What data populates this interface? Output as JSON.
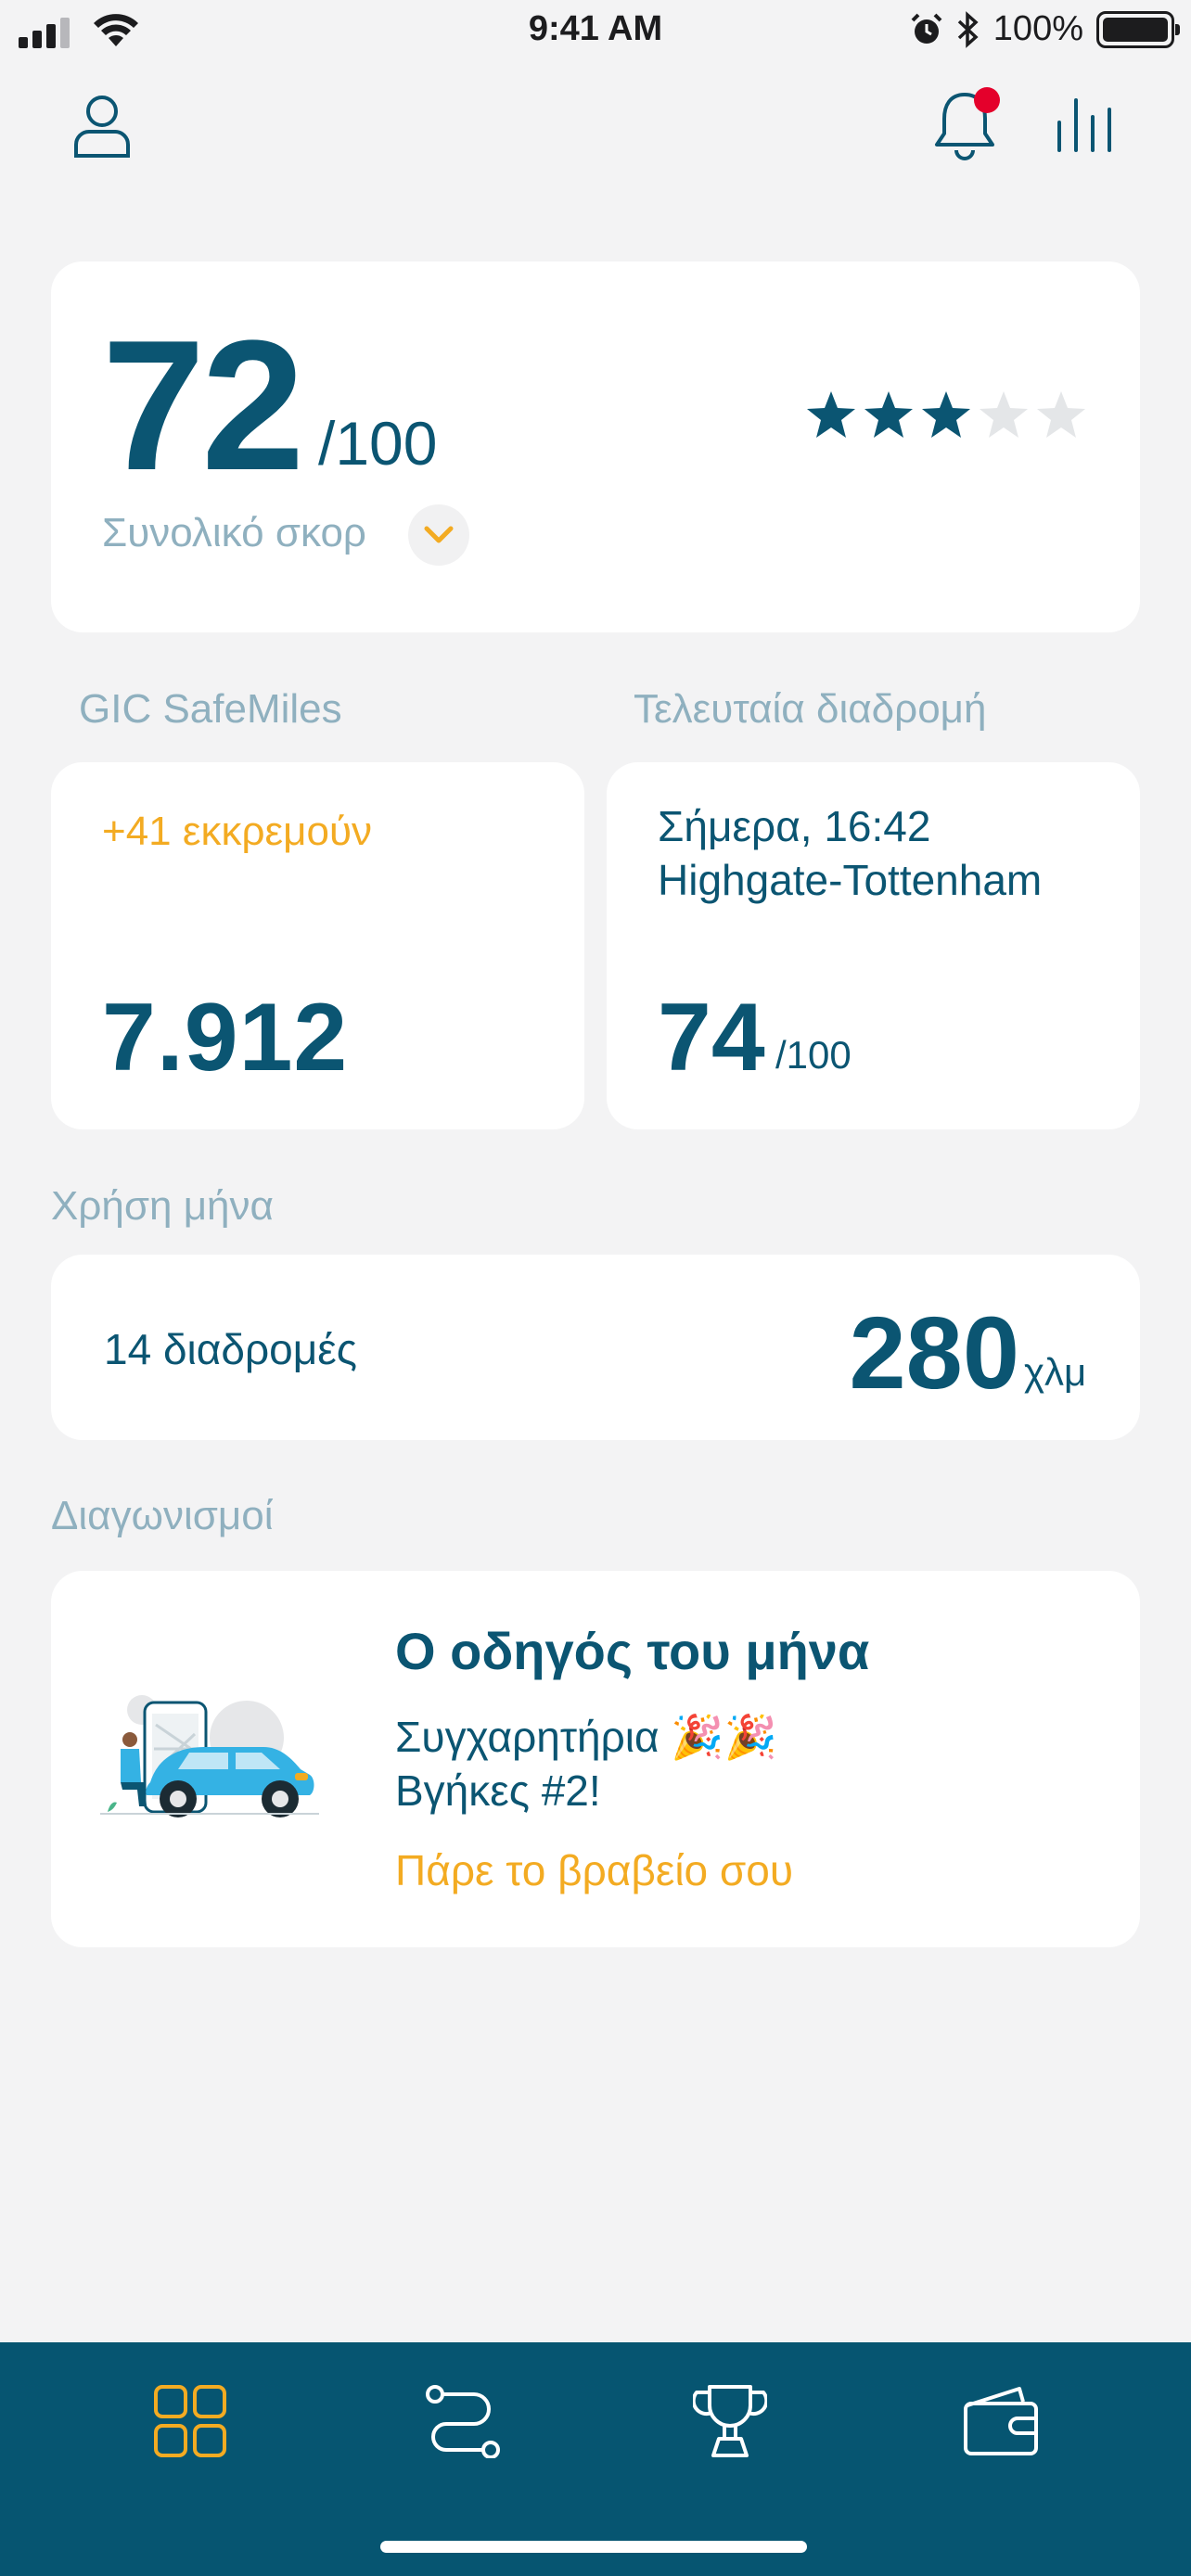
{
  "status_bar": {
    "time": "9:41 AM",
    "battery": "100%",
    "icons": [
      "signal-icon",
      "wifi-icon",
      "alarm-icon",
      "bluetooth-icon",
      "battery-icon"
    ]
  },
  "header": {
    "icons": [
      "profile-icon",
      "notification-bell-icon",
      "stats-icon"
    ],
    "has_notification": true
  },
  "score_card": {
    "score": "72",
    "out_of": "/100",
    "label": "Συνολικό σκορ",
    "stars_filled": 3,
    "stars_total": 5
  },
  "safemiles": {
    "section_title": "GIC SafeMiles",
    "pending": "+41 εκκρεμούν",
    "value": "7.912"
  },
  "last_trip": {
    "section_title": "Τελευταία διαδρομή",
    "when": "Σήμερα, 16:42",
    "route": "Highgate-Tottenham",
    "score": "74",
    "out_of": "/100"
  },
  "monthly_usage": {
    "section_title": "Χρήση μήνα",
    "trips": "14 διαδρομές",
    "distance": "280",
    "unit": "χλμ"
  },
  "competitions": {
    "section_title": "Διαγωνισμοί",
    "title": "Ο οδηγός του μήνα",
    "line1": "Συγχαρητήρια 🎉🎉",
    "line2": "Βγήκες #2!",
    "link": "Πάρε το βραβείο σου"
  },
  "tabbar": {
    "tabs": [
      "home-grid-icon",
      "route-icon",
      "trophy-icon",
      "wallet-icon"
    ],
    "active": "home-grid-icon"
  },
  "colors": {
    "primary": "#0b5572",
    "accent": "#f3ab22",
    "muted": "#8fb0bf",
    "background": "#f3f3f4",
    "tabbar": "#065571",
    "badge": "#e4002b",
    "star_empty": "#e4e6e8"
  }
}
